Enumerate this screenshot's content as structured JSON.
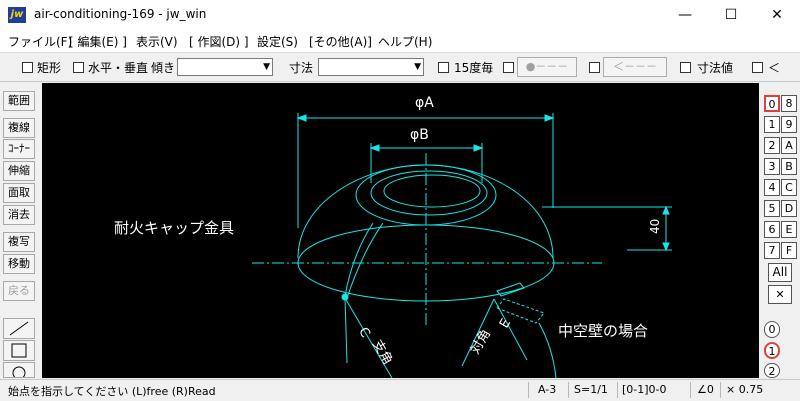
{
  "window": {
    "icon_text": "jw",
    "title": "air-conditioning-169 - jw_win",
    "minimize": "—",
    "maximize": "☐",
    "close": "✕"
  },
  "menu": [
    "ファイル(F)",
    "[ 編集(E) ]",
    "表示(V)",
    "[ 作図(D) ]",
    "設定(S)",
    "[その他(A)]",
    "ヘルプ(H)"
  ],
  "toolbar": {
    "rect": "矩形",
    "hv": "水平・垂直",
    "angle": "傾き",
    "dim": "寸法",
    "deg15": "15度毎",
    "btn1": "●－－－",
    "btn2": "＜－－－",
    "dimval": "寸法値",
    "lt": "＜"
  },
  "left_tools": [
    "範囲",
    "複線",
    "ｺｰﾅｰ",
    "伸縮",
    "面取",
    "消去",
    "複写",
    "移動",
    "戻る"
  ],
  "left_draw_icons": [
    "line-icon",
    "rectangle-icon",
    "circle-icon"
  ],
  "layers": {
    "col1": [
      "0",
      "1",
      "2",
      "3",
      "4",
      "5",
      "6",
      "7"
    ],
    "col2": [
      "8",
      "9",
      "A",
      "B",
      "C",
      "D",
      "E",
      "F"
    ],
    "all": "All",
    "x": "✕",
    "groups": [
      "0",
      "1",
      "2"
    ]
  },
  "drawing": {
    "label_phiA": "φA",
    "label_phiB": "φB",
    "label_40": "40",
    "title_text": "耐火キャップ金具",
    "hollow_wall": "中空壁の場合",
    "label_C": "C",
    "label_E": "E",
    "label_support": "支角",
    "label_counter": "対角",
    "colors": {
      "line": "#19e6e6",
      "text": "#ffffff",
      "bg": "#000000"
    }
  },
  "status": {
    "message": "始点を指示してください (L)free (R)Read",
    "paper": "A-3",
    "scale": "S=1/1",
    "layer": "[0-1]0-0",
    "angle": "∠0",
    "zoom": "× 0.75"
  }
}
